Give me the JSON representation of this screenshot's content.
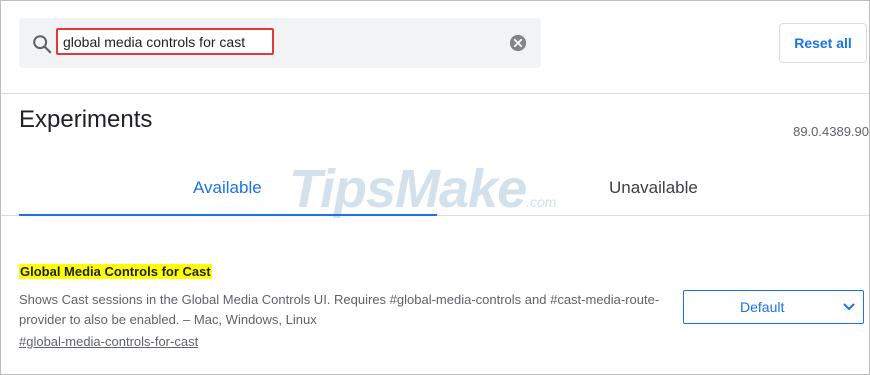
{
  "search": {
    "value": "global media controls for cast",
    "icon": "search-icon",
    "clear_icon": "clear-icon"
  },
  "toolbar": {
    "reset_label": "Reset all"
  },
  "header": {
    "title": "Experiments",
    "version": "89.0.4389.90"
  },
  "tabs": [
    {
      "label": "Available",
      "active": true
    },
    {
      "label": "Unavailable",
      "active": false
    }
  ],
  "watermark": {
    "main": "TipsMake",
    "suffix": ".com"
  },
  "experiment": {
    "title": "Global Media Controls for Cast",
    "description": "Shows Cast sessions in the Global Media Controls UI. Requires #global-media-controls and #cast-media-route-provider to also be enabled. – Mac, Windows, Linux",
    "link": "#global-media-controls-for-cast",
    "selected_option": "Default"
  },
  "colors": {
    "accent": "#1a73e8",
    "highlight": "#ffff00",
    "search_outline": "#e53935",
    "search_background": "#f1f3f4"
  }
}
